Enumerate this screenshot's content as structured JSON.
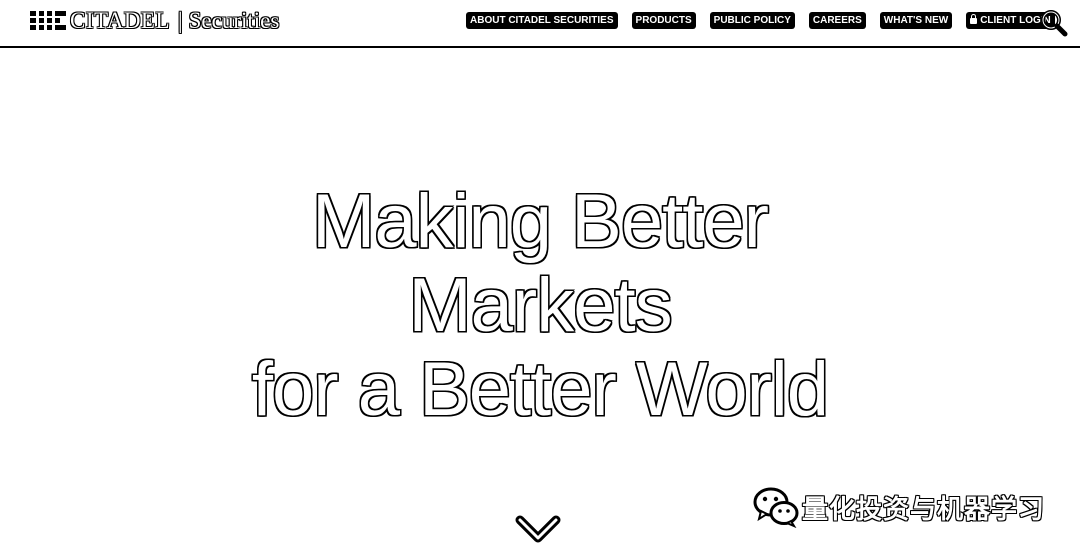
{
  "header": {
    "logo": {
      "name": "CITADEL",
      "separator": "|",
      "sub": "Securities",
      "icon": "citadel-logo-mark"
    },
    "nav": [
      {
        "label": "ABOUT CITADEL SECURITIES"
      },
      {
        "label": "PRODUCTS"
      },
      {
        "label": "PUBLIC POLICY"
      },
      {
        "label": "CAREERS"
      },
      {
        "label": "WHAT'S NEW"
      },
      {
        "label": "CLIENT LOGIN",
        "icon": "lock-icon"
      }
    ],
    "search_icon": "search-icon"
  },
  "hero": {
    "lines": [
      "Making Better",
      "Markets",
      "for a Better World"
    ]
  },
  "scroll_icon": "chevron-down-icon",
  "watermark": {
    "icon": "wechat-icon",
    "text": "量化投资与机器学习"
  },
  "colors": {
    "background": "#ffffff",
    "foreground": "#000000"
  }
}
